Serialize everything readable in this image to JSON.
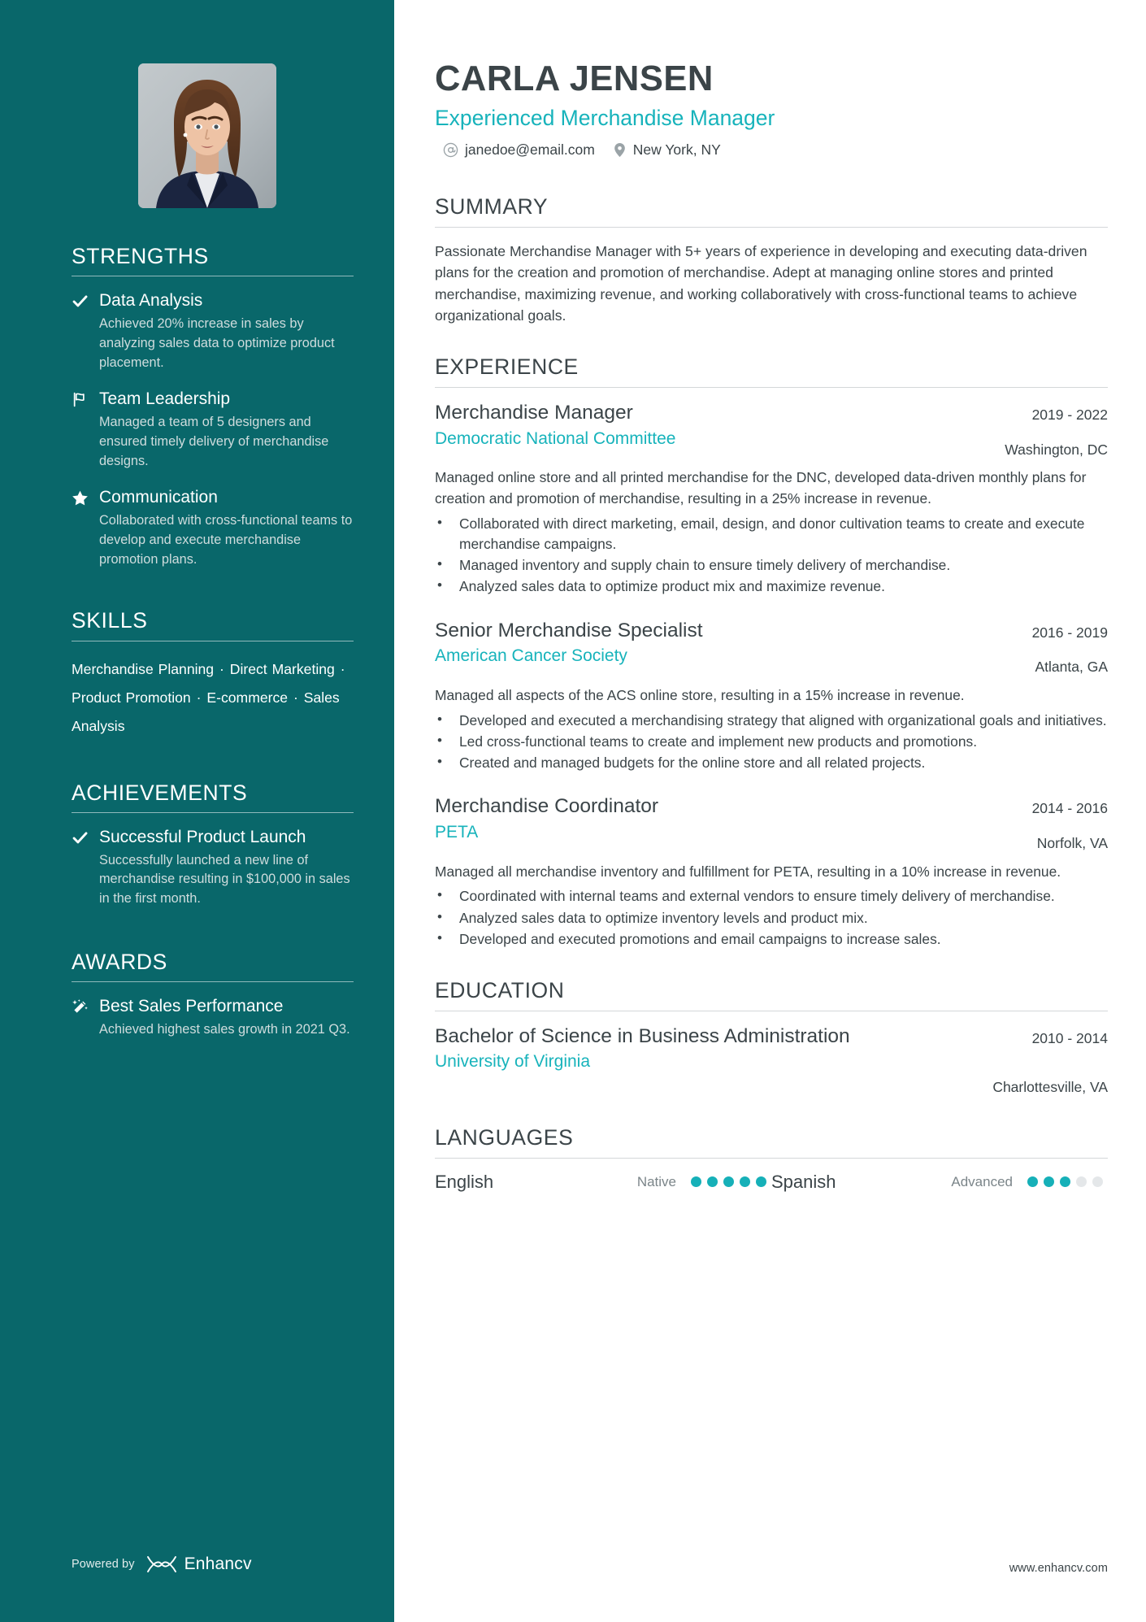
{
  "theme": {
    "sidebar_bg": "#09676a",
    "accent": "#17b3bb",
    "text": "#3b4448",
    "muted": "#7b8589"
  },
  "header": {
    "name": "CARLA JENSEN",
    "title": "Experienced Merchandise Manager",
    "contacts": [
      {
        "icon": "at-icon",
        "value": "janedoe@email.com"
      },
      {
        "icon": "location-pin-icon",
        "value": "New York, NY"
      }
    ]
  },
  "sidebar": {
    "strengths": {
      "heading": "STRENGTHS",
      "items": [
        {
          "icon": "check-icon",
          "title": "Data Analysis",
          "desc": "Achieved 20% increase in sales by analyzing sales data to optimize product placement."
        },
        {
          "icon": "flag-icon",
          "title": "Team Leadership",
          "desc": "Managed a team of 5 designers and ensured timely delivery of merchandise designs."
        },
        {
          "icon": "star-icon",
          "title": "Communication",
          "desc": "Collaborated with cross-functional teams to develop and execute merchandise promotion plans."
        }
      ]
    },
    "skills": {
      "heading": "SKILLS",
      "items": [
        "Merchandise Planning",
        "Direct Marketing",
        "Product Promotion",
        "E-commerce",
        "Sales Analysis"
      ],
      "separator": "·"
    },
    "achievements": {
      "heading": "ACHIEVEMENTS",
      "items": [
        {
          "icon": "check-icon",
          "title": "Successful Product Launch",
          "desc": "Successfully launched a new line of merchandise resulting in $100,000 in sales in the first month."
        }
      ]
    },
    "awards": {
      "heading": "AWARDS",
      "items": [
        {
          "icon": "magic-wand-icon",
          "title": "Best Sales Performance",
          "desc": "Achieved highest sales growth in 2021 Q3."
        }
      ]
    },
    "footer": {
      "powered_by": "Powered by",
      "brand": "Enhancv"
    }
  },
  "main": {
    "summary": {
      "heading": "SUMMARY",
      "text": "Passionate Merchandise Manager with 5+ years of experience in developing and executing data-driven plans for the creation and promotion of merchandise. Adept at managing online stores and printed merchandise, maximizing revenue, and working collaboratively with cross-functional teams to achieve organizational goals."
    },
    "experience": {
      "heading": "EXPERIENCE",
      "entries": [
        {
          "title": "Merchandise Manager",
          "org": "Democratic National Committee",
          "date": "2019 - 2022",
          "location": "Washington, DC",
          "desc": "Managed online store and all printed merchandise for the DNC, developed data-driven monthly plans for creation and promotion of merchandise, resulting in a 25% increase in revenue.",
          "bullets": [
            "Collaborated with direct marketing, email, design, and donor cultivation teams to create and execute merchandise campaigns.",
            "Managed inventory and supply chain to ensure timely delivery of merchandise.",
            "Analyzed sales data to optimize product mix and maximize revenue."
          ]
        },
        {
          "title": "Senior Merchandise Specialist",
          "org": "American Cancer Society",
          "date": "2016 - 2019",
          "location": "Atlanta, GA",
          "desc": "Managed all aspects of the ACS online store, resulting in a 15% increase in revenue.",
          "bullets": [
            "Developed and executed a merchandising strategy that aligned with organizational goals and initiatives.",
            "Led cross-functional teams to create and implement new products and promotions.",
            "Created and managed budgets for the online store and all related projects."
          ]
        },
        {
          "title": "Merchandise Coordinator",
          "org": "PETA",
          "date": "2014 - 2016",
          "location": "Norfolk, VA",
          "desc": "Managed all merchandise inventory and fulfillment for PETA, resulting in a 10% increase in revenue.",
          "bullets": [
            "Coordinated with internal teams and external vendors to ensure timely delivery of merchandise.",
            "Analyzed sales data to optimize inventory levels and product mix.",
            "Developed and executed promotions and email campaigns to increase sales."
          ]
        }
      ]
    },
    "education": {
      "heading": "EDUCATION",
      "entries": [
        {
          "title": "Bachelor of Science in Business Administration",
          "org": "University of Virginia",
          "date": "2010 - 2014",
          "location": "Charlottesville, VA"
        }
      ]
    },
    "languages": {
      "heading": "LANGUAGES",
      "items": [
        {
          "name": "English",
          "level": "Native",
          "filled": 5,
          "total": 5
        },
        {
          "name": "Spanish",
          "level": "Advanced",
          "filled": 3,
          "total": 5
        }
      ]
    },
    "footer": {
      "website": "www.enhancv.com"
    }
  }
}
